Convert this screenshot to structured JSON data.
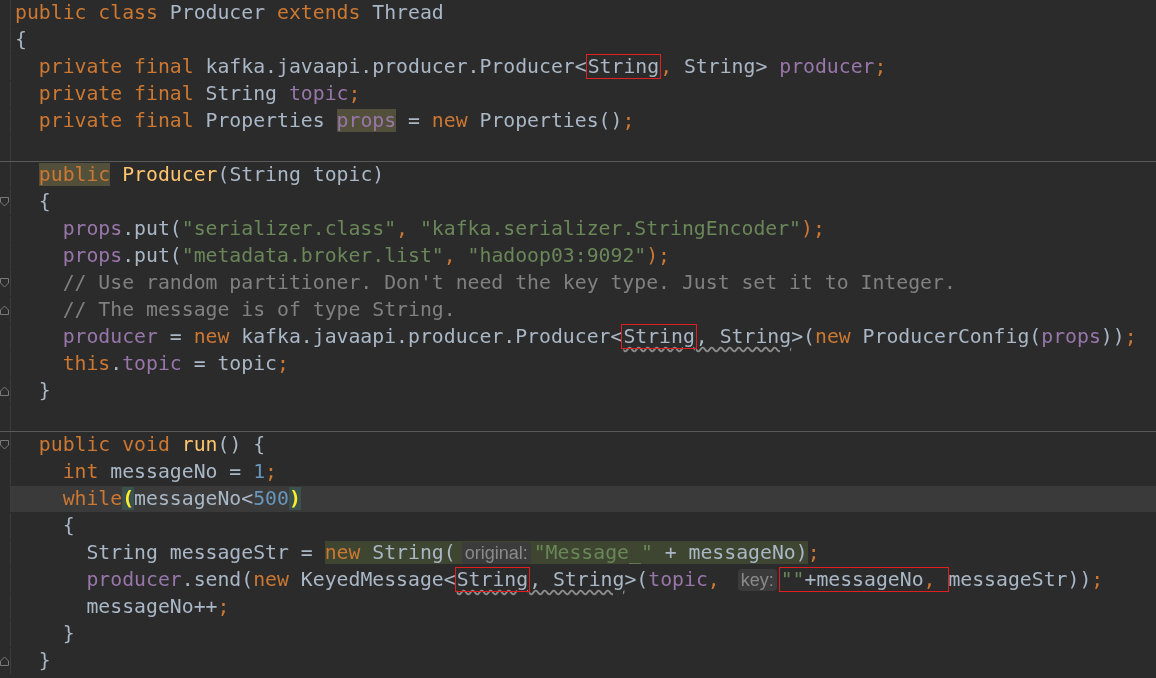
{
  "editor": {
    "lines": [
      {
        "kind": "code",
        "current": false,
        "separator": false,
        "tokens": [
          {
            "text": "public class ",
            "kind": "kw"
          },
          {
            "text": "Producer ",
            "kind": "plain"
          },
          {
            "text": "extends ",
            "kind": "kw"
          },
          {
            "text": "Thread",
            "kind": "plain"
          }
        ]
      },
      {
        "kind": "code",
        "current": false,
        "separator": false,
        "tokens": [
          {
            "text": "{",
            "kind": "plain"
          }
        ]
      },
      {
        "children": [
          {
            "kind": "code",
            "current": false,
            "separator": false,
            "tokens": [
              {
                "text": "private final ",
                "kind": "kw"
              },
              {
                "text": "kafka.javaapi.producer.Producer<",
                "kind": "plain"
              },
              {
                "kind": "boxed",
                "tokens": [
                  {
                    "text": "String",
                    "kind": "plain"
                  }
                ]
              },
              {
                "text": ",",
                "kind": "kw"
              },
              {
                "text": " String> ",
                "kind": "plain"
              },
              {
                "text": "producer",
                "kind": "field"
              },
              {
                "text": ";",
                "kind": "kw"
              }
            ]
          },
          {
            "kind": "code",
            "current": false,
            "separator": false,
            "tokens": [
              {
                "text": "private final ",
                "kind": "kw"
              },
              {
                "text": "String ",
                "kind": "plain"
              },
              {
                "text": "topic",
                "kind": "field"
              },
              {
                "text": ";",
                "kind": "kw"
              }
            ]
          },
          {
            "kind": "code",
            "current": false,
            "separator": false,
            "tokens": [
              {
                "text": "private final ",
                "kind": "kw"
              },
              {
                "text": "Properties ",
                "kind": "plain"
              },
              {
                "text": "props",
                "kind": "usage-field"
              },
              {
                "text": " = ",
                "kind": "plain"
              },
              {
                "text": "new ",
                "kind": "kw"
              },
              {
                "text": "Properties()",
                "kind": "plain"
              },
              {
                "text": ";",
                "kind": "kw"
              }
            ]
          },
          {
            "kind": "code",
            "current": false,
            "separator": true
          },
          {
            "kind": "code",
            "current": false,
            "separator": false,
            "tokens": [
              {
                "text": "public",
                "kind": "usage-kw"
              },
              {
                "text": " Producer",
                "kind": "decl"
              },
              {
                "text": "(String topic)",
                "kind": "plain"
              }
            ]
          },
          {
            "kind": "fold-start",
            "current": false,
            "separator": false,
            "tokens": [
              {
                "text": "{",
                "kind": "plain"
              }
            ]
          },
          {
            "children": [
              {
                "kind": "code",
                "current": false,
                "separator": false,
                "tokens": [
                  {
                    "text": "props",
                    "kind": "field"
                  },
                  {
                    "text": ".put(",
                    "kind": "plain"
                  },
                  {
                    "text": "\"serializer.class\"",
                    "kind": "str"
                  },
                  {
                    "text": ", ",
                    "kind": "kw"
                  },
                  {
                    "text": "\"kafka.serializer.StringEncoder\"",
                    "kind": "str"
                  },
                  {
                    "text": ");",
                    "kind": "kw"
                  }
                ]
              },
              {
                "kind": "code",
                "current": false,
                "separator": false,
                "tokens": [
                  {
                    "text": "props",
                    "kind": "field"
                  },
                  {
                    "text": ".put(",
                    "kind": "plain"
                  },
                  {
                    "text": "\"metadata.broker.list\"",
                    "kind": "str"
                  },
                  {
                    "text": ", ",
                    "kind": "kw"
                  },
                  {
                    "text": "\"hadoop03:9092\"",
                    "kind": "str"
                  },
                  {
                    "text": ");",
                    "kind": "kw"
                  }
                ]
              },
              {
                "kind": "fold-start",
                "current": false,
                "separator": false,
                "tokens": [
                  {
                    "text": "// Use random partitioner. Don't need the key type. Just set it to Integer.",
                    "kind": "comment"
                  }
                ]
              },
              {
                "kind": "fold-end",
                "current": false,
                "separator": false,
                "tokens": [
                  {
                    "text": "// The message is of type String.",
                    "kind": "comment"
                  }
                ]
              },
              {
                "kind": "code",
                "current": false,
                "separator": false,
                "tokens": [
                  {
                    "text": "producer",
                    "kind": "field"
                  },
                  {
                    "text": " = ",
                    "kind": "plain"
                  },
                  {
                    "text": "new ",
                    "kind": "kw"
                  },
                  {
                    "text": "kafka.javaapi.producer.Producer<",
                    "kind": "plain"
                  },
                  {
                    "kind": "boxed",
                    "tokens": [
                      {
                        "text": "String",
                        "kind": "type-warn"
                      }
                    ]
                  },
                  {
                    "text": ", String",
                    "kind": "type-warn"
                  },
                  {
                    "text": ">(",
                    "kind": "plain"
                  },
                  {
                    "text": "new ",
                    "kind": "kw"
                  },
                  {
                    "text": "ProducerConfig(",
                    "kind": "plain"
                  },
                  {
                    "text": "props",
                    "kind": "field"
                  },
                  {
                    "text": "))",
                    "kind": "plain"
                  },
                  {
                    "text": ";",
                    "kind": "kw"
                  }
                ]
              },
              {
                "kind": "code",
                "current": false,
                "separator": false,
                "tokens": [
                  {
                    "text": "this",
                    "kind": "kw"
                  },
                  {
                    "text": ".",
                    "kind": "plain"
                  },
                  {
                    "text": "topic",
                    "kind": "field"
                  },
                  {
                    "text": " = topic",
                    "kind": "plain"
                  },
                  {
                    "text": ";",
                    "kind": "kw"
                  }
                ]
              }
            ]
          },
          {
            "kind": "fold-end",
            "current": false,
            "separator": false,
            "tokens": [
              {
                "text": "}",
                "kind": "plain"
              }
            ]
          },
          {
            "kind": "code",
            "current": false,
            "separator": true
          },
          {
            "kind": "fold-start",
            "current": false,
            "separator": false,
            "tokens": [
              {
                "text": "public void ",
                "kind": "kw"
              },
              {
                "text": "run",
                "kind": "decl"
              },
              {
                "text": "() {",
                "kind": "plain"
              }
            ]
          },
          {
            "children": [
              {
                "kind": "code",
                "current": false,
                "separator": false,
                "tokens": [
                  {
                    "text": "int ",
                    "kind": "kw"
                  },
                  {
                    "text": "messageNo = ",
                    "kind": "plain"
                  },
                  {
                    "text": "1",
                    "kind": "num"
                  },
                  {
                    "text": ";",
                    "kind": "kw"
                  }
                ]
              },
              {
                "kind": "code",
                "current": true,
                "separator": false,
                "tokens": [
                  {
                    "text": "while",
                    "kind": "kw"
                  },
                  {
                    "text": "(",
                    "kind": "brace"
                  },
                  {
                    "text": "messageNo<",
                    "kind": "plain"
                  },
                  {
                    "text": "500",
                    "kind": "num"
                  },
                  {
                    "text": ")",
                    "kind": "brace"
                  }
                ]
              },
              {
                "kind": "code",
                "current": false,
                "separator": false,
                "tokens": [
                  {
                    "text": "{",
                    "kind": "plain"
                  }
                ]
              },
              {
                "children": [
                  {
                    "kind": "code",
                    "current": false,
                    "separator": false,
                    "tokens": [
                      {
                        "text": "String messageStr = ",
                        "kind": "plain"
                      },
                      {
                        "kind": "injected",
                        "tokens": [
                          {
                            "text": "new ",
                            "kind": "kw"
                          },
                          {
                            "text": "String(",
                            "kind": "plain"
                          },
                          {
                            "text": "original:",
                            "kind": "hint"
                          },
                          {
                            "text": "\"Message_\"",
                            "kind": "str"
                          },
                          {
                            "text": " + messageNo)",
                            "kind": "plain"
                          }
                        ]
                      },
                      {
                        "text": ";",
                        "kind": "kw"
                      }
                    ]
                  },
                  {
                    "kind": "code",
                    "current": false,
                    "separator": false,
                    "tokens": [
                      {
                        "text": "producer",
                        "kind": "field"
                      },
                      {
                        "text": ".send(",
                        "kind": "plain"
                      },
                      {
                        "text": "new ",
                        "kind": "kw"
                      },
                      {
                        "text": "KeyedMessage<",
                        "kind": "plain"
                      },
                      {
                        "kind": "boxed",
                        "tokens": [
                          {
                            "text": "String",
                            "kind": "type-warn"
                          }
                        ]
                      },
                      {
                        "text": ", String",
                        "kind": "type-warn"
                      },
                      {
                        "text": ">(",
                        "kind": "plain"
                      },
                      {
                        "text": "topic",
                        "kind": "field"
                      },
                      {
                        "text": ", ",
                        "kind": "kw"
                      },
                      {
                        "text": "key:",
                        "kind": "hint"
                      },
                      {
                        "kind": "boxed",
                        "tokens": [
                          {
                            "text": "\"\"",
                            "kind": "str"
                          },
                          {
                            "text": "+messageNo",
                            "kind": "plain"
                          },
                          {
                            "text": ", ",
                            "kind": "kw"
                          }
                        ]
                      },
                      {
                        "text": "messageStr))",
                        "kind": "plain"
                      },
                      {
                        "text": ";",
                        "kind": "kw"
                      }
                    ]
                  },
                  {
                    "kind": "code",
                    "current": false,
                    "separator": false,
                    "tokens": [
                      {
                        "text": "messageNo++",
                        "kind": "plain"
                      },
                      {
                        "text": ";",
                        "kind": "kw"
                      }
                    ]
                  }
                ]
              },
              {
                "kind": "code",
                "current": false,
                "separator": false,
                "tokens": [
                  {
                    "text": "}",
                    "kind": "plain"
                  }
                ]
              }
            ]
          },
          {
            "kind": "fold-end",
            "current": false,
            "separator": false,
            "tokens": [
              {
                "text": "}",
                "kind": "plain"
              }
            ]
          }
        ]
      }
    ]
  }
}
